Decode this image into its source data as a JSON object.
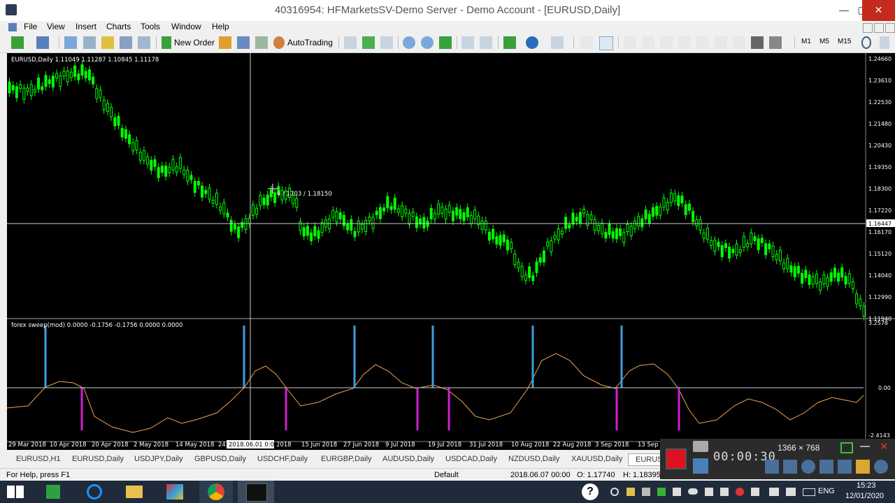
{
  "window": {
    "title": "40316954: HFMarketsSV-Demo Server - Demo Account - [EURUSD,Daily]",
    "minimize": "—",
    "maximize": "▢",
    "close": "✕"
  },
  "menu": {
    "items": [
      "File",
      "View",
      "Insert",
      "Charts",
      "Tools",
      "Window",
      "Help"
    ]
  },
  "toolbar": {
    "new_order": "New Order",
    "autotrading": "AutoTrading",
    "m1": "M1",
    "m5": "M5",
    "m15": "M15"
  },
  "chart": {
    "header": "EURUSD,Daily  1.11049 1.11287 1.10845 1.11178",
    "price_labels": [
      "1.24660",
      "1.23610",
      "1.22530",
      "1.21480",
      "1.20430",
      "1.19350",
      "1.18300",
      "1.17220",
      "1.16447",
      "1.16170",
      "1.15120",
      "1.14040",
      "1.12990",
      "1.11940"
    ],
    "current_price": "1.16447",
    "crosshair_label": "4 / 1703 / 1.18150",
    "date_labels": [
      "29 Mar 2018",
      "10 Apr 2018",
      "20 Apr 2018",
      "2 May 2018",
      "14 May 2018",
      "24",
      "2018",
      "15 Jun 2018",
      "27 Jun 2018",
      "9 Jul 2018",
      "19 Jul 2018",
      "31 Jul 2018",
      "10 Aug 2018",
      "22 Aug 2018",
      "3 Sep 2018",
      "13 Sep"
    ],
    "crosshair_date": "2018.06.01 0:00"
  },
  "indicator": {
    "header": "forex sweep(mod) 0.0000 -0.1756 -0.1756 0.0000 0.0000",
    "scale_top": "3.2578",
    "scale_mid": "0.00",
    "scale_bottom": "-2.4143",
    "colors": {
      "line": "#f0a050",
      "up": "#3b9fe0",
      "down": "#d020d0",
      "candle": "#00ff00"
    }
  },
  "tabs": [
    "EURUSD,H1",
    "EURUSD,Daily",
    "USDJPY,Daily",
    "GBPUSD,Daily",
    "USDCHF,Daily",
    "EURGBP,Daily",
    "AUDUSD,Daily",
    "USDCAD,Daily",
    "NZDUSD,Daily",
    "XAUUSD,Daily",
    "EURUS"
  ],
  "status": {
    "help": "For Help, press F1",
    "profile": "Default",
    "datetime": "2018.06.07 00:00",
    "open": "O: 1.17740",
    "high": "H: 1.18395"
  },
  "recorder": {
    "resolution": "1366 × 768",
    "timer": "00:00:30"
  },
  "taskbar": {
    "lang": "ENG",
    "time": "15:23",
    "date": "12/01/2020"
  }
}
